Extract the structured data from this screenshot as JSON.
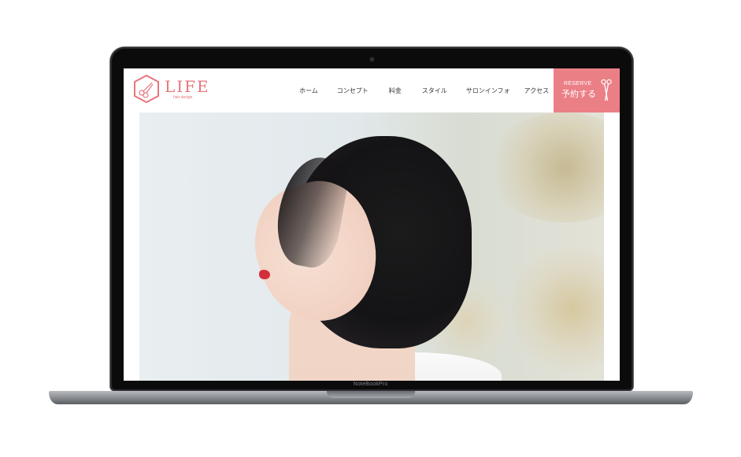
{
  "device": {
    "label": "NoteBookPro"
  },
  "site": {
    "logo": {
      "word": "LIFE",
      "sub": "hair design"
    },
    "nav": {
      "items": [
        {
          "label": "ホーム"
        },
        {
          "label": "コンセプト"
        },
        {
          "label": "料金"
        },
        {
          "label": "スタイル"
        },
        {
          "label": "サロンインフォ"
        },
        {
          "label": "アクセス"
        }
      ]
    },
    "reserve": {
      "en": "RESERVE",
      "jp": "予約する"
    }
  },
  "colors": {
    "accent": "#eb7f86",
    "logo": "#e7757c"
  },
  "icons": {
    "logo": "scissors-hexagon-icon",
    "reserve": "scissors-icon"
  }
}
